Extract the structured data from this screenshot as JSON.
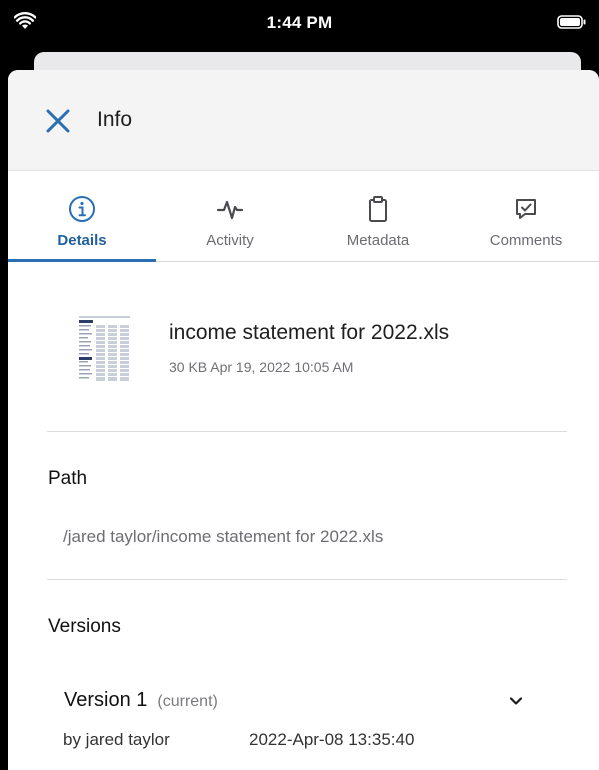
{
  "status_bar": {
    "time": "1:44 PM"
  },
  "header": {
    "title": "Info"
  },
  "tabs": [
    {
      "label": "Details",
      "icon": "info-icon",
      "active": true
    },
    {
      "label": "Activity",
      "icon": "activity-icon",
      "active": false
    },
    {
      "label": "Metadata",
      "icon": "clipboard-icon",
      "active": false
    },
    {
      "label": "Comments",
      "icon": "comment-icon",
      "active": false
    }
  ],
  "file": {
    "name": "income statement for 2022.xls",
    "meta": "30 KB Apr 19, 2022 10:05 AM"
  },
  "path": {
    "title": "Path",
    "value": "/jared taylor/income statement for 2022.xls"
  },
  "versions": {
    "title": "Versions",
    "items": [
      {
        "name": "Version 1",
        "tag": "(current)",
        "by": "by jared taylor",
        "date": "2022-Apr-08 13:35:40"
      }
    ]
  },
  "colors": {
    "accent": "#2a6fb3",
    "active_tab_text": "#1f5f9c",
    "header_bg": "#f4f4f5"
  }
}
